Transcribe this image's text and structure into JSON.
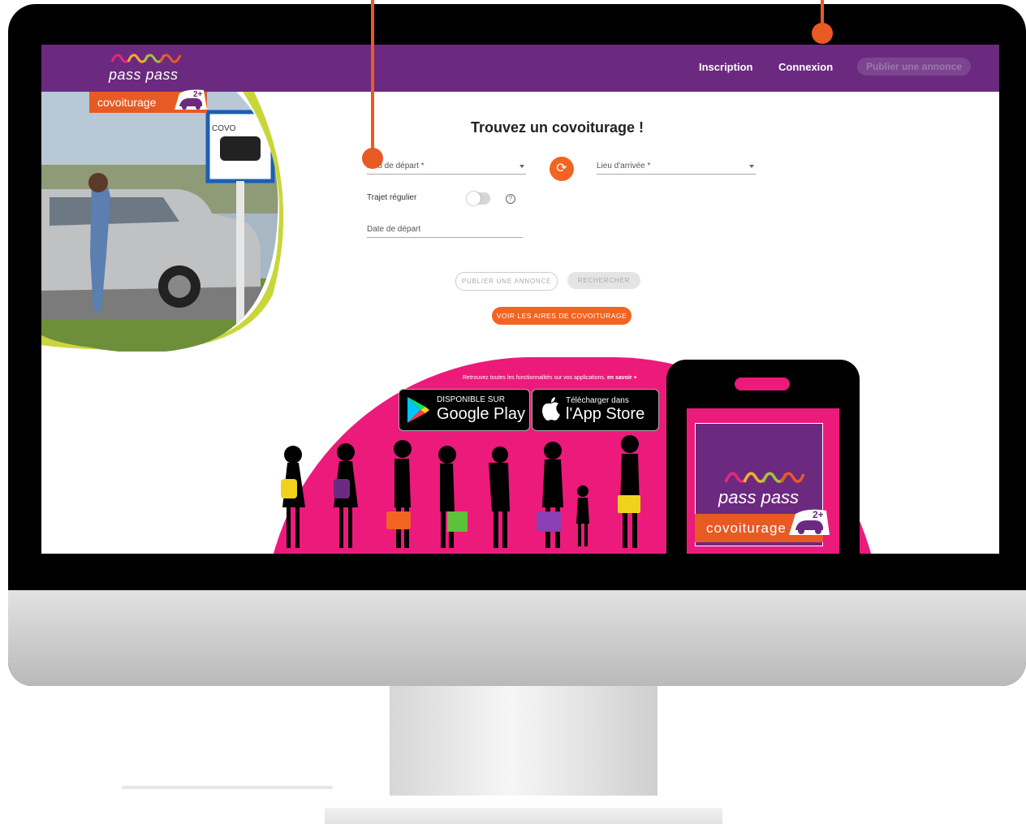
{
  "header": {
    "logo_text": "pass pass",
    "logo_tag": "covoiturage",
    "logo_badge": "2+",
    "nav": {
      "inscription": "Inscription",
      "connexion": "Connexion",
      "publish": "Publier une annonce"
    }
  },
  "search": {
    "title": "Trouvez un covoiturage !",
    "departure_placeholder": "Lieu de départ *",
    "arrival_placeholder": "Lieu d'arrivée *",
    "regular_trip_label": "Trajet régulier",
    "help_glyph": "?",
    "date_placeholder": "Date de départ",
    "publish_button": "PUBLIER UNE ANNONCE",
    "search_button": "RECHERCHER",
    "aires_button": "VOIR LES AIRES DE COVOITURAGE",
    "regular_trip_enabled": false
  },
  "photo": {
    "sign_text": "COVO"
  },
  "apps": {
    "info_text": "Retrouvez toutes les fonctionnalités sur vos applications,",
    "info_link": "en savoir +",
    "google_small": "DISPONIBLE SUR",
    "google_big": "Google Play",
    "apple_small": "Télécharger dans",
    "apple_big": "l'App Store"
  },
  "phone": {
    "logo_text": "pass pass",
    "tag": "covoiturage",
    "badge": "2+"
  },
  "icons": [
    "swap-icon",
    "caret-down-icon",
    "help-icon",
    "google-play-icon",
    "apple-icon",
    "car-icon"
  ],
  "colors": {
    "brand_purple": "#6b2a7f",
    "brand_orange": "#f26422",
    "brand_pink": "#ec1a7b"
  }
}
